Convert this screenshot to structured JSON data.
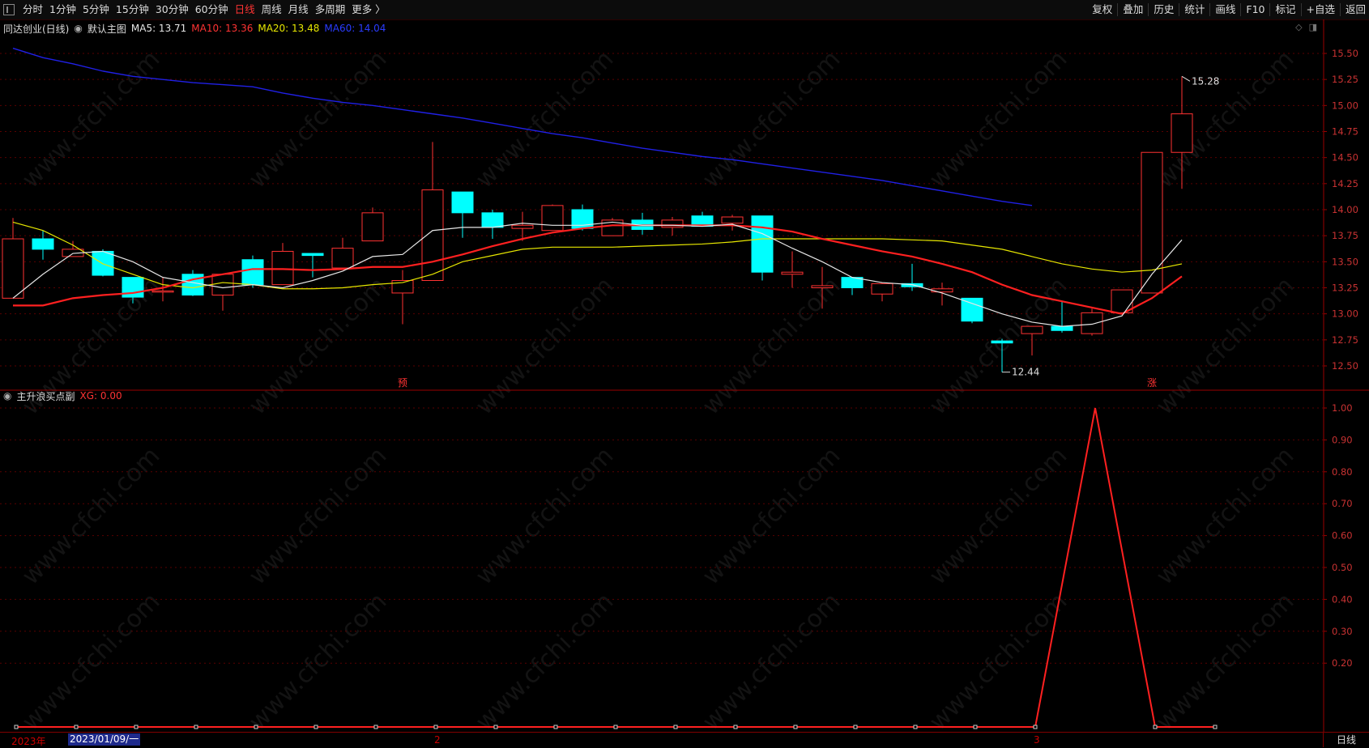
{
  "toolbar": {
    "periods": [
      "分时",
      "1分钟",
      "5分钟",
      "15分钟",
      "30分钟",
      "60分钟",
      "日线",
      "周线",
      "月线",
      "多周期",
      "更多 〉"
    ],
    "active_period": "日线",
    "right_items": [
      "复权",
      "叠加",
      "历史",
      "统计",
      "画线",
      "F10",
      "标记",
      "+自选",
      "返回"
    ]
  },
  "legend": {
    "stock": "同达创业(日线)",
    "main_chart": "默认主图",
    "ma5": "MA5: 13.71",
    "ma10": "MA10: 13.36",
    "ma20": "MA20: 13.48",
    "ma60": "MA60: 14.04"
  },
  "indicator": {
    "name": "主升浪买点副",
    "xg": "XG: 0.00"
  },
  "annotations": {
    "high_label": "15.28",
    "low_label": "12.44",
    "marker_1": "预",
    "marker_2": "涨"
  },
  "bottom": {
    "year_label": "2023年",
    "selected_date": "2023/01/09/一",
    "month_2": "2",
    "month_3": "3",
    "period_badge": "日线"
  },
  "watermark": "www.cfchi.com",
  "colors": {
    "up": "#ff3232",
    "down": "#00ffff",
    "ma5": "#e6e6e6",
    "ma10": "#ff2020",
    "ma20": "#e6e600",
    "ma60": "#2020e6",
    "axis": "#9a0000"
  },
  "chart_data": {
    "type": "candlestick",
    "price_axis": {
      "min": 12.5,
      "max": 15.5,
      "ticks": [
        "15.50",
        "15.25",
        "15.00",
        "14.75",
        "14.50",
        "14.25",
        "14.00",
        "13.75",
        "13.50",
        "13.25",
        "13.00",
        "12.75",
        "12.50"
      ]
    },
    "candles": [
      {
        "o": 13.15,
        "h": 13.92,
        "l": 13.42,
        "c": 13.72
      },
      {
        "o": 13.72,
        "h": 13.8,
        "l": 13.52,
        "c": 13.62
      },
      {
        "o": 13.55,
        "h": 13.7,
        "l": 13.55,
        "c": 13.62
      },
      {
        "o": 13.6,
        "h": 13.62,
        "l": 13.36,
        "c": 13.37
      },
      {
        "o": 13.35,
        "h": 13.35,
        "l": 13.1,
        "c": 13.16
      },
      {
        "o": 13.22,
        "h": 13.35,
        "l": 13.12,
        "c": 13.22
      },
      {
        "o": 13.38,
        "h": 13.42,
        "l": 13.17,
        "c": 13.18
      },
      {
        "o": 13.18,
        "h": 13.37,
        "l": 13.03,
        "c": 13.38
      },
      {
        "o": 13.52,
        "h": 13.56,
        "l": 13.25,
        "c": 13.28
      },
      {
        "o": 13.28,
        "h": 13.68,
        "l": 13.28,
        "c": 13.6
      },
      {
        "o": 13.58,
        "h": 13.58,
        "l": 13.35,
        "c": 13.56
      },
      {
        "o": 13.44,
        "h": 13.73,
        "l": 13.45,
        "c": 13.63
      },
      {
        "o": 13.7,
        "h": 14.02,
        "l": 13.7,
        "c": 13.97
      },
      {
        "o": 13.2,
        "h": 13.42,
        "l": 12.9,
        "c": 13.32
      },
      {
        "o": 13.32,
        "h": 14.65,
        "l": 13.32,
        "c": 14.19
      },
      {
        "o": 14.17,
        "h": 14.17,
        "l": 13.73,
        "c": 13.97
      },
      {
        "o": 13.97,
        "h": 14.0,
        "l": 13.72,
        "c": 13.83
      },
      {
        "o": 13.82,
        "h": 13.98,
        "l": 13.7,
        "c": 13.85
      },
      {
        "o": 13.8,
        "h": 14.05,
        "l": 13.8,
        "c": 14.04
      },
      {
        "o": 14.0,
        "h": 14.05,
        "l": 13.8,
        "c": 13.82
      },
      {
        "o": 13.75,
        "h": 13.92,
        "l": 13.75,
        "c": 13.9
      },
      {
        "o": 13.9,
        "h": 13.97,
        "l": 13.76,
        "c": 13.81
      },
      {
        "o": 13.83,
        "h": 13.93,
        "l": 13.75,
        "c": 13.9
      },
      {
        "o": 13.94,
        "h": 13.98,
        "l": 13.84,
        "c": 13.84
      },
      {
        "o": 13.87,
        "h": 13.95,
        "l": 13.8,
        "c": 13.93
      },
      {
        "o": 13.94,
        "h": 13.94,
        "l": 13.32,
        "c": 13.4
      },
      {
        "o": 13.38,
        "h": 13.6,
        "l": 13.25,
        "c": 13.4
      },
      {
        "o": 13.25,
        "h": 13.45,
        "l": 13.05,
        "c": 13.27
      },
      {
        "o": 13.35,
        "h": 13.35,
        "l": 13.18,
        "c": 13.25
      },
      {
        "o": 13.19,
        "h": 13.3,
        "l": 13.12,
        "c": 13.29
      },
      {
        "o": 13.29,
        "h": 13.48,
        "l": 13.22,
        "c": 13.26
      },
      {
        "o": 13.21,
        "h": 13.3,
        "l": 13.08,
        "c": 13.24
      },
      {
        "o": 13.15,
        "h": 13.15,
        "l": 12.91,
        "c": 12.93
      },
      {
        "o": 12.74,
        "h": 12.76,
        "l": 12.44,
        "c": 12.72
      },
      {
        "o": 12.81,
        "h": 12.88,
        "l": 12.6,
        "c": 12.88
      },
      {
        "o": 12.88,
        "h": 13.12,
        "l": 12.82,
        "c": 12.84
      },
      {
        "o": 12.81,
        "h": 13.05,
        "l": 12.79,
        "c": 13.01
      },
      {
        "o": 13.01,
        "h": 13.21,
        "l": 13.01,
        "c": 13.23
      },
      {
        "o": 13.2,
        "h": 14.55,
        "l": 13.2,
        "c": 14.55
      },
      {
        "o": 14.55,
        "h": 15.28,
        "l": 14.2,
        "c": 14.92
      }
    ],
    "ma5": [
      13.15,
      13.38,
      13.58,
      13.6,
      13.5,
      13.35,
      13.3,
      13.25,
      13.28,
      13.25,
      13.32,
      13.41,
      13.55,
      13.57,
      13.8,
      13.83,
      13.83,
      13.87,
      13.85,
      13.85,
      13.88,
      13.85,
      13.85,
      13.84,
      13.86,
      13.77,
      13.63,
      13.5,
      13.35,
      13.3,
      13.28,
      13.2,
      13.1,
      13.0,
      12.92,
      12.88,
      12.9,
      12.98,
      13.38,
      13.71
    ],
    "ma10": [
      13.08,
      13.08,
      13.15,
      13.18,
      13.2,
      13.25,
      13.33,
      13.38,
      13.43,
      13.43,
      13.42,
      13.43,
      13.45,
      13.45,
      13.5,
      13.57,
      13.65,
      13.72,
      13.78,
      13.82,
      13.85,
      13.85,
      13.85,
      13.85,
      13.85,
      13.83,
      13.79,
      13.72,
      13.66,
      13.6,
      13.55,
      13.48,
      13.4,
      13.28,
      13.18,
      13.12,
      13.06,
      13.0,
      13.15,
      13.36
    ],
    "ma20": [
      13.88,
      13.8,
      13.66,
      13.48,
      13.38,
      13.28,
      13.25,
      13.3,
      13.28,
      13.24,
      13.24,
      13.25,
      13.28,
      13.3,
      13.38,
      13.5,
      13.56,
      13.62,
      13.64,
      13.64,
      13.64,
      13.65,
      13.66,
      13.67,
      13.69,
      13.72,
      13.72,
      13.72,
      13.72,
      13.72,
      13.71,
      13.7,
      13.66,
      13.62,
      13.55,
      13.48,
      13.43,
      13.4,
      13.42,
      13.48
    ],
    "ma60": [
      15.55,
      15.46,
      15.4,
      15.33,
      15.28,
      15.25,
      15.22,
      15.2,
      15.18,
      15.12,
      15.07,
      15.03,
      15.0,
      14.96,
      14.92,
      14.88,
      14.83,
      14.78,
      14.73,
      14.69,
      14.64,
      14.59,
      14.55,
      14.51,
      14.48,
      14.44,
      14.4,
      14.36,
      14.32,
      14.28,
      14.23,
      14.18,
      14.13,
      14.08,
      14.04
    ],
    "indicator_axis": {
      "min": 0,
      "max": 1,
      "ticks": [
        "1.00",
        "0.90",
        "0.80",
        "0.70",
        "0.60",
        "0.50",
        "0.40",
        "0.30",
        "0.20"
      ]
    },
    "xg": [
      0,
      0,
      0,
      0,
      0,
      0,
      0,
      0,
      0,
      0,
      0,
      0,
      0,
      0,
      0,
      0,
      0,
      0,
      1,
      0,
      0
    ]
  }
}
